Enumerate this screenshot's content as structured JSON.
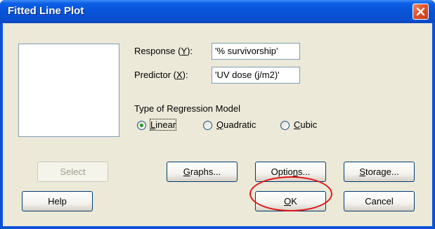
{
  "window": {
    "title": "Fitted Line Plot",
    "close_icon": "close-icon"
  },
  "form": {
    "response": {
      "label_pre": "Response (",
      "label_key": "Y",
      "label_post": "):",
      "value": "'% survivorship'"
    },
    "predictor": {
      "label_pre": "Predictor (",
      "label_key": "X",
      "label_post": "):",
      "value": "'UV dose (j/m2)'"
    },
    "model": {
      "heading": "Type of Regression Model",
      "selected": "Linear",
      "options": [
        {
          "key": "L",
          "rest": "inear"
        },
        {
          "key": "Q",
          "rest": "uadratic"
        },
        {
          "key": "C",
          "rest": "ubic"
        }
      ]
    }
  },
  "buttons": {
    "select": "Select",
    "graphs": {
      "key": "G",
      "rest": "raphs..."
    },
    "options": {
      "pre": "Optio",
      "key": "n",
      "post": "s..."
    },
    "storage": {
      "key": "S",
      "rest": "torage..."
    },
    "help": "Help",
    "ok": {
      "key": "O",
      "rest": "K"
    },
    "cancel": "Cancel"
  },
  "annotation": {
    "color": "#e01616"
  },
  "colors": {
    "titlebar": "#0852d6",
    "dialog_bg": "#ece9d8",
    "close_button": "#e0532b"
  }
}
